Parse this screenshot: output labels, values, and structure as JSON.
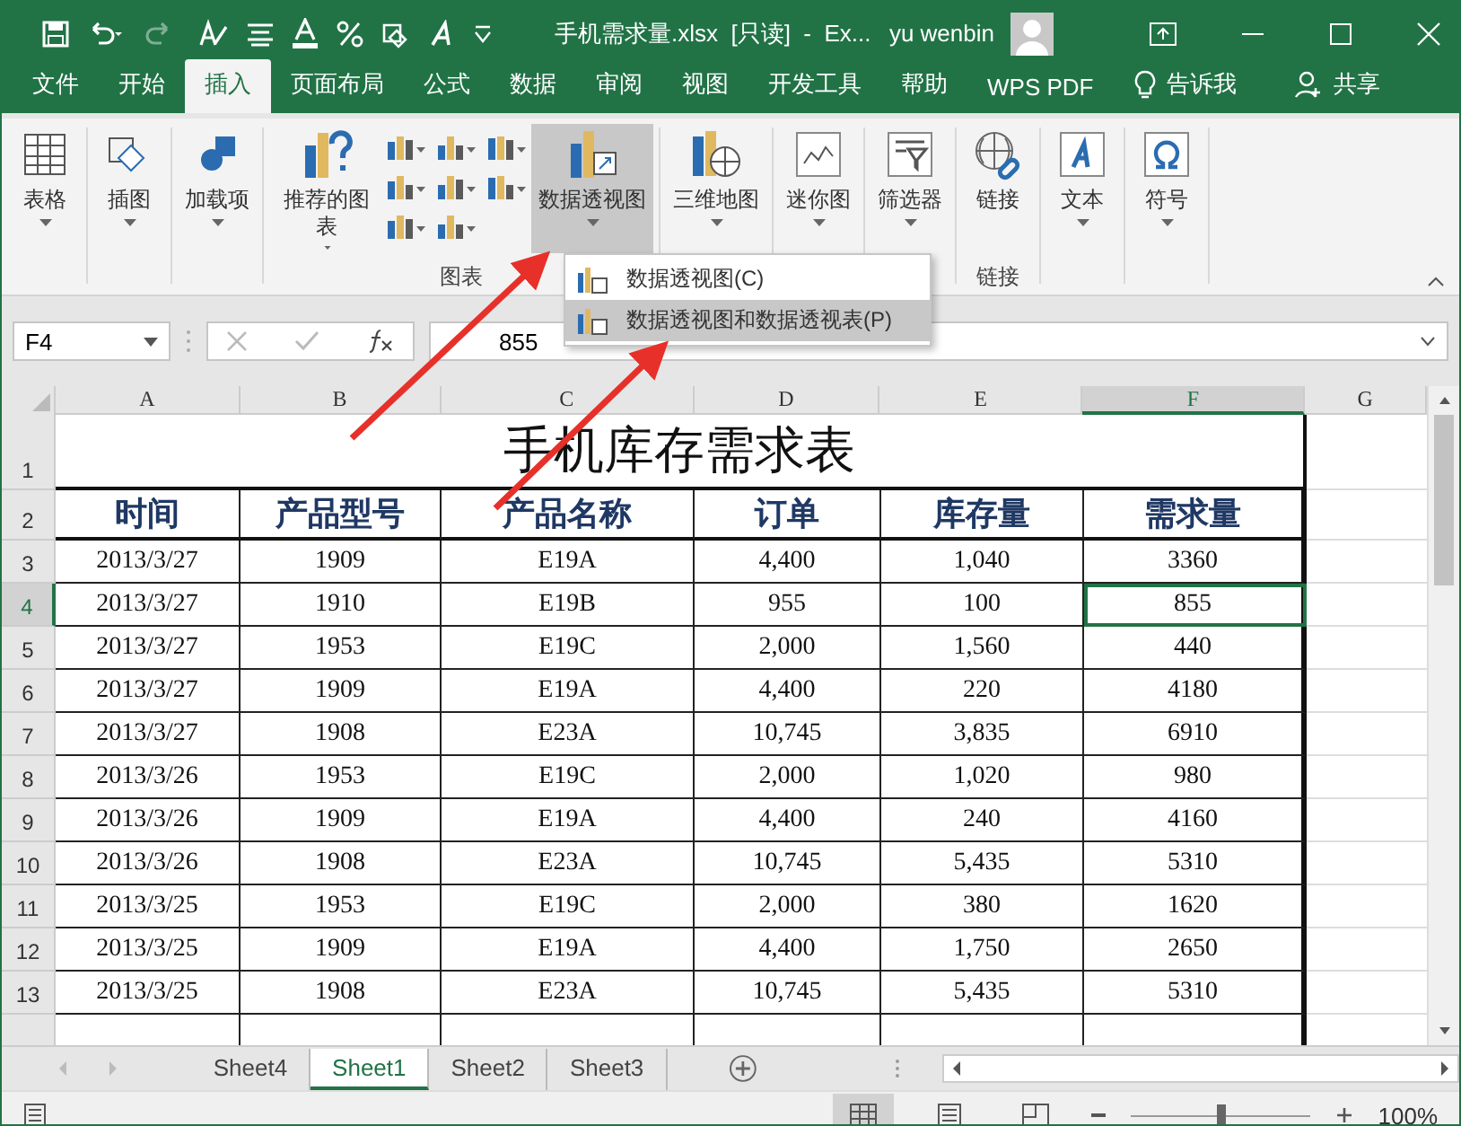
{
  "title_bar": {
    "title": "手机需求量.xlsx  [只读]  -  Ex...",
    "user": "yu wenbin"
  },
  "menu_tabs": [
    {
      "label": "文件",
      "selected": false
    },
    {
      "label": "开始",
      "selected": false
    },
    {
      "label": "插入",
      "selected": true
    },
    {
      "label": "页面布局",
      "selected": false
    },
    {
      "label": "公式",
      "selected": false
    },
    {
      "label": "数据",
      "selected": false
    },
    {
      "label": "审阅",
      "selected": false
    },
    {
      "label": "视图",
      "selected": false
    },
    {
      "label": "开发工具",
      "selected": false
    },
    {
      "label": "帮助",
      "selected": false
    },
    {
      "label": "WPS PDF",
      "selected": false
    }
  ],
  "tell_me": "告诉我",
  "share": "共享",
  "ribbon": {
    "groups": [
      {
        "buttons": [
          {
            "label": "表格",
            "selected": false
          }
        ]
      },
      {
        "buttons": [
          {
            "label": "插图",
            "selected": false
          }
        ]
      },
      {
        "buttons": [
          {
            "label": "加载项",
            "selected": false
          }
        ]
      },
      {
        "label": "图表",
        "buttons": [
          {
            "label": "推荐的图表",
            "selected": false
          },
          {
            "label": "数据透视图",
            "selected": true
          }
        ]
      },
      {
        "buttons": [
          {
            "label": "三维地图",
            "selected": false
          }
        ]
      },
      {
        "buttons": [
          {
            "label": "迷你图",
            "selected": false
          }
        ]
      },
      {
        "buttons": [
          {
            "label": "筛选器",
            "selected": false
          }
        ]
      },
      {
        "label": "链接",
        "buttons": [
          {
            "label": "链接",
            "selected": false
          }
        ]
      },
      {
        "buttons": [
          {
            "label": "文本",
            "selected": false
          }
        ]
      },
      {
        "buttons": [
          {
            "label": "符号",
            "selected": false
          }
        ]
      }
    ]
  },
  "dropdown_menu": [
    {
      "label": "数据透视图(C)",
      "selected": false
    },
    {
      "label": "数据透视图和数据透视表(P)",
      "selected": true
    }
  ],
  "formula_bar": {
    "name_box": "F4",
    "value": "855"
  },
  "sheet": {
    "columns": [
      {
        "label": "A",
        "selected": false
      },
      {
        "label": "B",
        "selected": false
      },
      {
        "label": "C",
        "selected": false
      },
      {
        "label": "D",
        "selected": false
      },
      {
        "label": "E",
        "selected": false
      },
      {
        "label": "F",
        "selected": true
      },
      {
        "label": "G",
        "selected": false
      }
    ],
    "title_row": {
      "number": "1",
      "text": "手机库存需求表"
    },
    "header_row": {
      "number": "2",
      "cells": [
        "时间",
        "产品型号",
        "产品名称",
        "订单",
        "库存量",
        "需求量"
      ]
    },
    "rows": [
      {
        "number": "3",
        "selected": false,
        "cells": [
          {
            "text": "2013/3/27",
            "selected": false
          },
          {
            "text": "1909",
            "selected": false
          },
          {
            "text": "E19A",
            "selected": false
          },
          {
            "text": "4,400",
            "selected": false
          },
          {
            "text": "1,040",
            "selected": false
          },
          {
            "text": "3360",
            "selected": false
          }
        ]
      },
      {
        "number": "4",
        "selected": true,
        "cells": [
          {
            "text": "2013/3/27",
            "selected": false
          },
          {
            "text": "1910",
            "selected": false
          },
          {
            "text": "E19B",
            "selected": false
          },
          {
            "text": "955",
            "selected": false
          },
          {
            "text": "100",
            "selected": false
          },
          {
            "text": "855",
            "selected": true
          }
        ]
      },
      {
        "number": "5",
        "selected": false,
        "cells": [
          {
            "text": "2013/3/27",
            "selected": false
          },
          {
            "text": "1953",
            "selected": false
          },
          {
            "text": "E19C",
            "selected": false
          },
          {
            "text": "2,000",
            "selected": false
          },
          {
            "text": "1,560",
            "selected": false
          },
          {
            "text": "440",
            "selected": false
          }
        ]
      },
      {
        "number": "6",
        "selected": false,
        "cells": [
          {
            "text": "2013/3/27",
            "selected": false
          },
          {
            "text": "1909",
            "selected": false
          },
          {
            "text": "E19A",
            "selected": false
          },
          {
            "text": "4,400",
            "selected": false
          },
          {
            "text": "220",
            "selected": false
          },
          {
            "text": "4180",
            "selected": false
          }
        ]
      },
      {
        "number": "7",
        "selected": false,
        "cells": [
          {
            "text": "2013/3/27",
            "selected": false
          },
          {
            "text": "1908",
            "selected": false
          },
          {
            "text": "E23A",
            "selected": false
          },
          {
            "text": "10,745",
            "selected": false
          },
          {
            "text": "3,835",
            "selected": false
          },
          {
            "text": "6910",
            "selected": false
          }
        ]
      },
      {
        "number": "8",
        "selected": false,
        "cells": [
          {
            "text": "2013/3/26",
            "selected": false
          },
          {
            "text": "1953",
            "selected": false
          },
          {
            "text": "E19C",
            "selected": false
          },
          {
            "text": "2,000",
            "selected": false
          },
          {
            "text": "1,020",
            "selected": false
          },
          {
            "text": "980",
            "selected": false
          }
        ]
      },
      {
        "number": "9",
        "selected": false,
        "cells": [
          {
            "text": "2013/3/26",
            "selected": false
          },
          {
            "text": "1909",
            "selected": false
          },
          {
            "text": "E19A",
            "selected": false
          },
          {
            "text": "4,400",
            "selected": false
          },
          {
            "text": "240",
            "selected": false
          },
          {
            "text": "4160",
            "selected": false
          }
        ]
      },
      {
        "number": "10",
        "selected": false,
        "cells": [
          {
            "text": "2013/3/26",
            "selected": false
          },
          {
            "text": "1908",
            "selected": false
          },
          {
            "text": "E23A",
            "selected": false
          },
          {
            "text": "10,745",
            "selected": false
          },
          {
            "text": "5,435",
            "selected": false
          },
          {
            "text": "5310",
            "selected": false
          }
        ]
      },
      {
        "number": "11",
        "selected": false,
        "cells": [
          {
            "text": "2013/3/25",
            "selected": false
          },
          {
            "text": "1953",
            "selected": false
          },
          {
            "text": "E19C",
            "selected": false
          },
          {
            "text": "2,000",
            "selected": false
          },
          {
            "text": "380",
            "selected": false
          },
          {
            "text": "1620",
            "selected": false
          }
        ]
      },
      {
        "number": "12",
        "selected": false,
        "cells": [
          {
            "text": "2013/3/25",
            "selected": false
          },
          {
            "text": "1909",
            "selected": false
          },
          {
            "text": "E19A",
            "selected": false
          },
          {
            "text": "4,400",
            "selected": false
          },
          {
            "text": "1,750",
            "selected": false
          },
          {
            "text": "2650",
            "selected": false
          }
        ]
      },
      {
        "number": "13",
        "selected": false,
        "cells": [
          {
            "text": "2013/3/25",
            "selected": false
          },
          {
            "text": "1908",
            "selected": false
          },
          {
            "text": "E23A",
            "selected": false
          },
          {
            "text": "10,745",
            "selected": false
          },
          {
            "text": "5,435",
            "selected": false
          },
          {
            "text": "5310",
            "selected": false
          }
        ]
      }
    ]
  },
  "sheet_tabs": [
    {
      "label": "Sheet4",
      "selected": false
    },
    {
      "label": "Sheet1",
      "selected": true
    },
    {
      "label": "Sheet2",
      "selected": false
    },
    {
      "label": "Sheet3",
      "selected": false
    }
  ],
  "status_bar": {
    "views": [
      {
        "selected": true
      },
      {
        "selected": false
      },
      {
        "selected": false
      }
    ],
    "zoom": {
      "level": 0.5,
      "reading": "100%"
    }
  }
}
